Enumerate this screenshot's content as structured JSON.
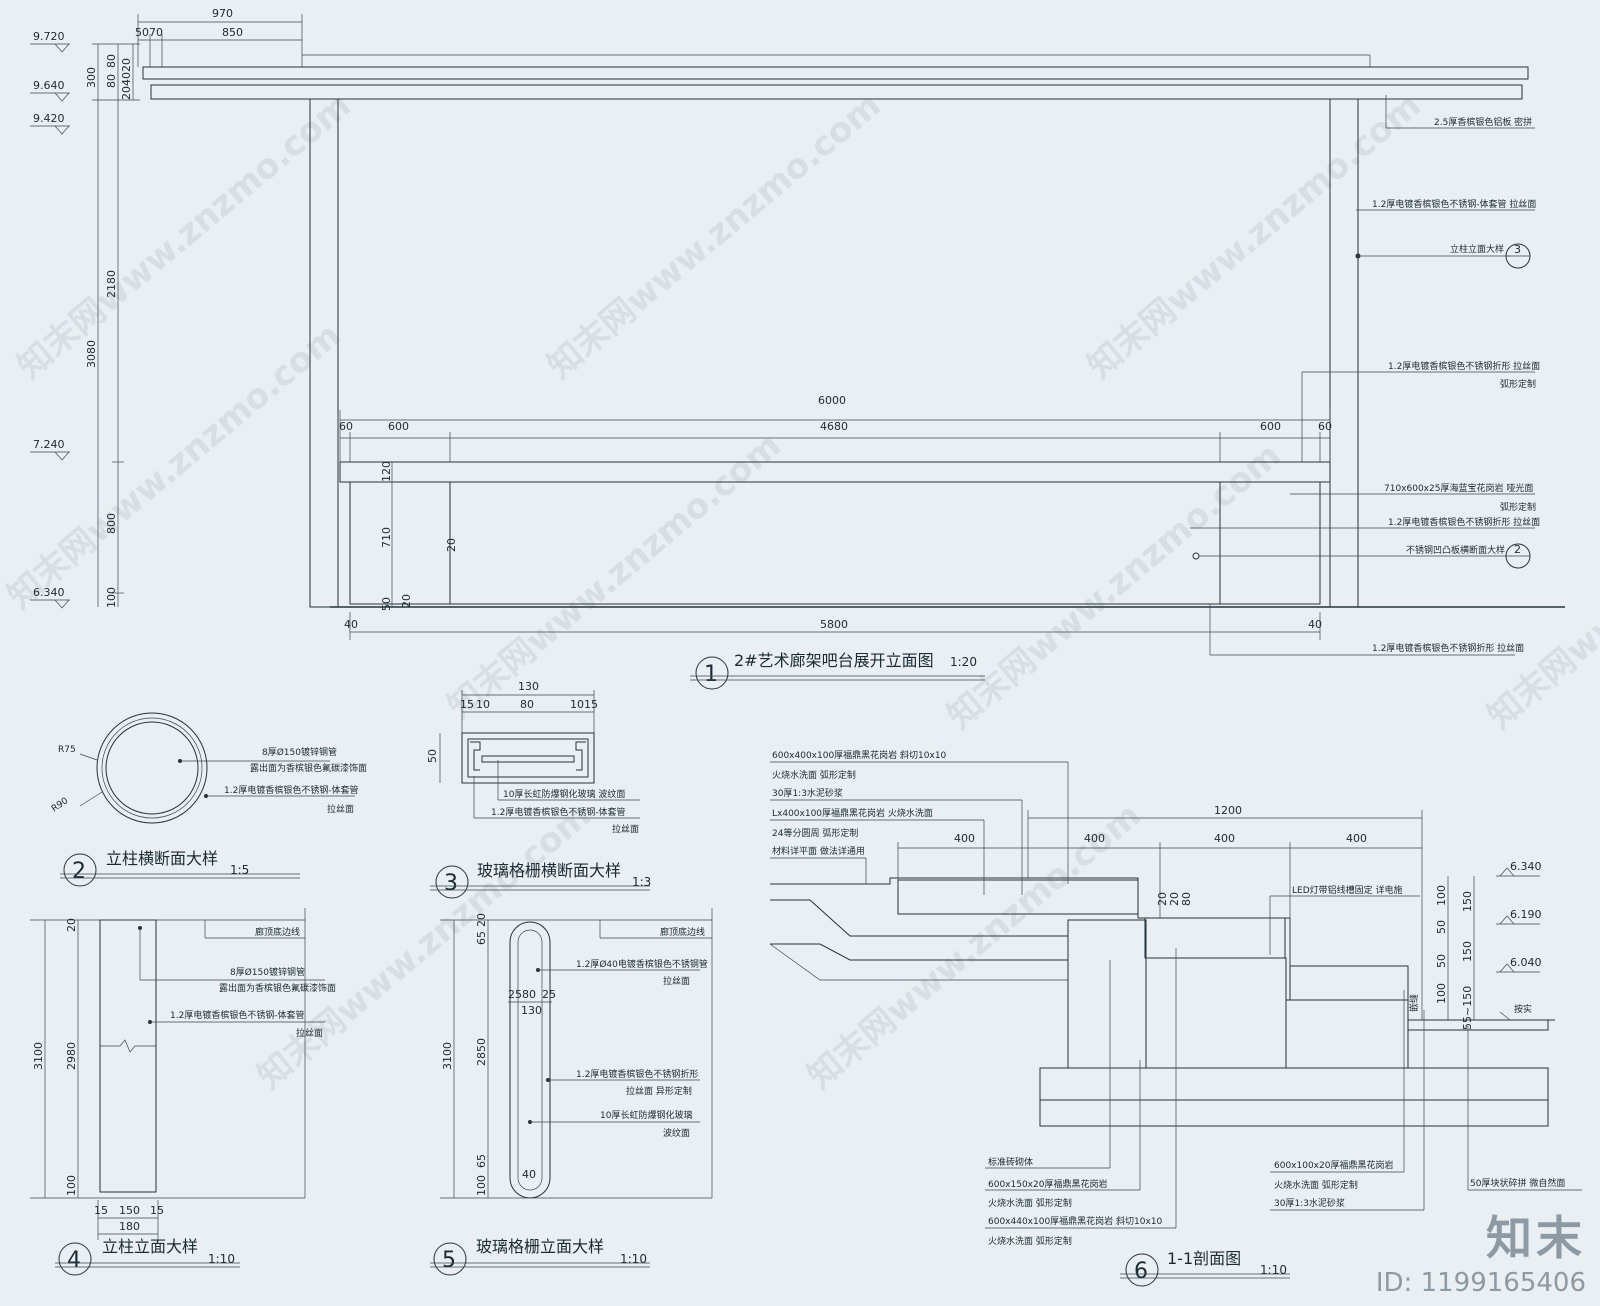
{
  "watermarks": {
    "site": "知末网www.znzmo.com",
    "logo": "知末",
    "id_label": "ID: 1199165406"
  },
  "view1": {
    "num": "1",
    "title": "2#艺术廊架吧台展开立面图",
    "scale": "1:20",
    "elev": [
      "9.720",
      "9.640",
      "9.420",
      "7.240",
      "6.340"
    ],
    "top_dims": {
      "d970": "970",
      "d50": "50",
      "d70": "70",
      "d850": "850"
    },
    "left_dims": {
      "d300": "300",
      "d80": "80",
      "d80b": "80",
      "d20": "20",
      "d40": "40",
      "d20b": "20",
      "d3080": "3080",
      "d2180": "2180",
      "d800": "800",
      "d100": "100"
    },
    "mid_dims": {
      "d6000": "6000",
      "d60a": "60",
      "d600a": "600",
      "d4680": "4680",
      "d600b": "600",
      "d60b": "60",
      "d120": "120",
      "d710": "710",
      "d50": "50",
      "d20a": "20",
      "d20b": "20"
    },
    "bot_dims": {
      "d40a": "40",
      "d5800": "5800",
      "d40b": "40"
    },
    "notes": {
      "n1": "2.5厚香槟银色铝板  密拼",
      "n2": "1.2厚电镀香槟银色不锈钢-体套管  拉丝面",
      "n3": "立柱立面大样",
      "n3c": "3",
      "n4a": "1.2厚电镀香槟银色不锈钢折形  拉丝面",
      "n4b": "弧形定制",
      "n5a": "710x600x25厚海蓝宝花岗岩  哑光面",
      "n5b": "弧形定制",
      "n6": "1.2厚电镀香槟银色不锈钢折形  拉丝面",
      "n7": "不锈钢凹凸板横断面大样",
      "n7c": "2",
      "n8": "1.2厚电镀香槟银色不锈钢折形  拉丝面"
    }
  },
  "view2": {
    "num": "2",
    "title": "立柱横断面大样",
    "scale": "1:5",
    "r75": "R75",
    "r90": "R90",
    "n1": "8厚Ø150镀锌钢管",
    "n2": "露出面为香槟银色氟碳漆饰面",
    "n3": "1.2厚电镀香槟银色不锈钢-体套管",
    "n4": "拉丝面"
  },
  "view3": {
    "num": "3",
    "title": "玻璃格栅横断面大样",
    "scale": "1:3",
    "d130": "130",
    "d15a": "15",
    "d10a": "10",
    "d80": "80",
    "d10b": "10",
    "d15b": "15",
    "d50": "50",
    "n1": "10厚长虹防爆钢化玻璃  波纹面",
    "n2": "1.2厚电镀香槟银色不锈钢-体套管",
    "n3": "拉丝面"
  },
  "view4": {
    "num": "4",
    "title": "立柱立面大样",
    "scale": "1:10",
    "d3100": "3100",
    "d2980": "2980",
    "d20": "20",
    "d100": "100",
    "d15a": "15",
    "d150": "150",
    "d15b": "15",
    "d180": "180",
    "n0": "廊顶底边线",
    "n1": "8厚Ø150镀锌钢管",
    "n2": "露出面为香槟银色氟碳漆饰面",
    "n3": "1.2厚电镀香槟银色不锈钢-体套管",
    "n4": "拉丝面"
  },
  "view5": {
    "num": "5",
    "title": "玻璃格栅立面大样",
    "scale": "1:10",
    "d3100": "3100",
    "d65": "65",
    "d20": "20",
    "d2850": "2850",
    "d65b": "65",
    "d100": "100",
    "d25a": "25",
    "d80": "80",
    "d25b": "25",
    "d130": "130",
    "d40": "40",
    "n0": "廊顶底边线",
    "n1": "1.2厚Ø40电镀香槟银色不锈钢管",
    "n1b": "拉丝面",
    "n2": "1.2厚电镀香槟银色不锈钢折形",
    "n2b": "拉丝面  异形定制",
    "n3": "10厚长虹防爆钢化玻璃",
    "n3b": "波纹面"
  },
  "view6": {
    "num": "6",
    "title": "1-1剖面图",
    "scale": "1:10",
    "d1200": "1200",
    "d400a": "400",
    "d400b": "400",
    "d400c": "400",
    "d400d": "400",
    "elev": [
      "6.340",
      "6.190",
      "6.040"
    ],
    "right_dims": [
      "100",
      "150",
      "50",
      "50",
      "150",
      "100",
      "55~150"
    ],
    "small": [
      "20",
      "20",
      "80"
    ],
    "n_top": [
      "600x400x100厚福鼎黑花岗岩  斜切10x10",
      "火烧水洗面  弧形定制",
      "30厚1:3水泥砂浆",
      "Lx400x100厚福鼎黑花岗岩  火烧水洗面",
      "24等分圆周  弧形定制",
      "材料详平面  做法详通用"
    ],
    "led": "LED灯带铝线槽固定  详电施",
    "rside": [
      "按实",
      "嵌缝"
    ],
    "n_bot": [
      "标准砖砌体",
      "600x150x20厚福鼎黑花岗岩",
      "火烧水洗面  弧形定制",
      "600x440x100厚福鼎黑花岗岩  斜切10x10",
      "火烧水洗面  弧形定制"
    ],
    "n_br": [
      "600x100x20厚福鼎黑花岗岩",
      "火烧水洗面  弧形定制",
      "30厚1:3水泥砂浆"
    ],
    "n_far": "50厚块状碎拼  微自然面"
  }
}
